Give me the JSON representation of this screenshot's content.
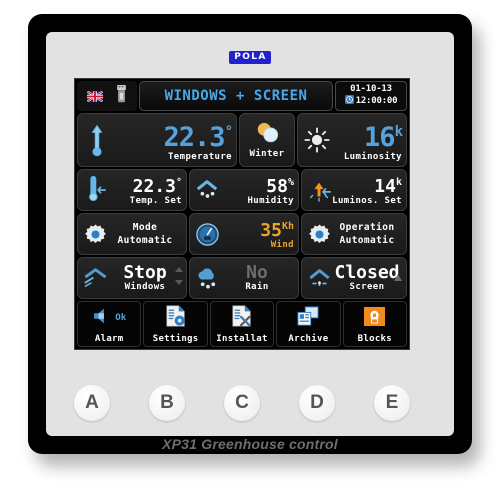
{
  "brand": {
    "logo": "POLA"
  },
  "device": {
    "model_label": "XP31 Greenhouse control"
  },
  "statusbar": {
    "flag_icon": "uk-flag-icon",
    "usb_icon": "usb-stick-icon",
    "title": "WINDOWS + SCREEN",
    "date": "01-10-13",
    "time": "12:00:00",
    "clock_icon": "clock-icon"
  },
  "tiles": {
    "temperature": {
      "icon": "thermometer-up-icon",
      "value": "22.3",
      "unit": "°",
      "label": "Temperature"
    },
    "season": {
      "icon": "snow-sun-icon",
      "label": "Winter"
    },
    "luminosity": {
      "icon": "sun-icon",
      "value": "16",
      "unit": "k",
      "label": "Luminosity"
    },
    "temp_set": {
      "icon": "thermometer-set-icon",
      "value": "22.3",
      "unit": "°",
      "label": "Temp. Set"
    },
    "humidity": {
      "icon": "humidity-icon",
      "value": "58",
      "unit": "%",
      "label": "Humidity"
    },
    "lum_set": {
      "icon": "luminosity-set-icon",
      "value": "14",
      "unit": "k",
      "label": "Luminos. Set"
    },
    "mode": {
      "icon": "gear-icon",
      "label": "Mode",
      "value": "Automatic"
    },
    "wind": {
      "icon": "anemometer-icon",
      "value": "35",
      "unit": "Kh",
      "label": "Wind"
    },
    "operation": {
      "icon": "gear-icon",
      "label": "Operation",
      "value": "Automatic"
    },
    "windows": {
      "icon": "window-vent-icon",
      "value": "Stop",
      "label": "Windows",
      "arrows_icon": "up-down-arrows-icon"
    },
    "rain": {
      "icon": "rain-cloud-icon",
      "value": "No",
      "label": "Rain"
    },
    "screen": {
      "icon": "screen-shade-icon",
      "value": "Closed",
      "label": "Screen",
      "arrows_icon": "up-arrow-icon"
    }
  },
  "toolbar": [
    {
      "icon": "speaker-icon",
      "badge": "Ok",
      "label": "Alarm"
    },
    {
      "icon": "document-gear-icon",
      "badge": "",
      "label": "Settings"
    },
    {
      "icon": "document-tools-icon",
      "badge": "",
      "label": "Installat"
    },
    {
      "icon": "windows-stack-icon",
      "badge": "",
      "label": "Archive"
    },
    {
      "icon": "padlock-icon",
      "badge": "",
      "label": "Blocks"
    }
  ],
  "keys": [
    "A",
    "B",
    "C",
    "D",
    "E"
  ],
  "colors": {
    "accent_blue": "#55a3dd",
    "title_blue": "#4aa8e8",
    "wind_orange": "#e8a52a",
    "disabled_grey": "#6d6d6d",
    "lock_orange": "#f08a1c"
  }
}
